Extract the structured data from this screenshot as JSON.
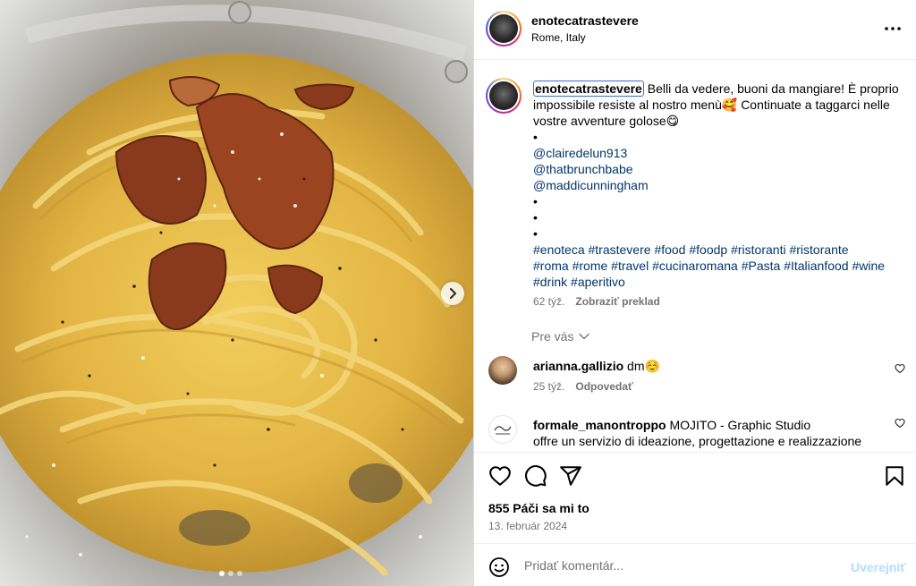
{
  "post": {
    "username": "enotecatrastevere",
    "location": "Rome, Italy",
    "caption_lines": [
      "Belli da vedere, buoni da mangiare! È proprio",
      "impossibile resiste al nostro menù🥰 Continuate a taggarci nelle",
      "vostre avventure golose😋"
    ],
    "bullets": [
      "•",
      "•",
      "•",
      "•"
    ],
    "mentions": [
      "@clairedelun913",
      "@thatbrunchbabe",
      "@maddicunningham"
    ],
    "hashtags": [
      "#enoteca",
      "#trastevere",
      "#food",
      "#foodp",
      "#ristoranti",
      "#ristorante",
      "#roma",
      "#rome",
      "#travel",
      "#cucinaromana",
      "#Pasta",
      "#Italianfood",
      "#wine",
      "#drink",
      "#aperitivo"
    ],
    "time_ago": "62 týž.",
    "translate_label": "Zobraziť preklad",
    "see_more_label": "Pre vás"
  },
  "comments": [
    {
      "username": "arianna.gallizio",
      "text": "dm☺️",
      "time_ago": "25 týž.",
      "reply_label": "Odpovedať"
    },
    {
      "username": "formale_manontroppo",
      "text": "MOJITO - Graphic Studio",
      "text_line2": "offre un servizio di ideazione, progettazione e realizzazione"
    }
  ],
  "actions": {
    "icons": [
      "heart-icon",
      "comment-icon",
      "share-icon",
      "bookmark-icon"
    ],
    "likes_label": "855 Páči sa mi to",
    "date_label": "13. február 2024"
  },
  "add_comment": {
    "placeholder": "Pridať komentár...",
    "post_label": "Uverejniť"
  },
  "colors": {
    "link": "#00376b",
    "muted": "#737373",
    "post_disabled": "#b3dbff",
    "focus_outline": "#3a6fd8"
  },
  "carousel": {
    "slides": 3,
    "active_slide": 1
  }
}
